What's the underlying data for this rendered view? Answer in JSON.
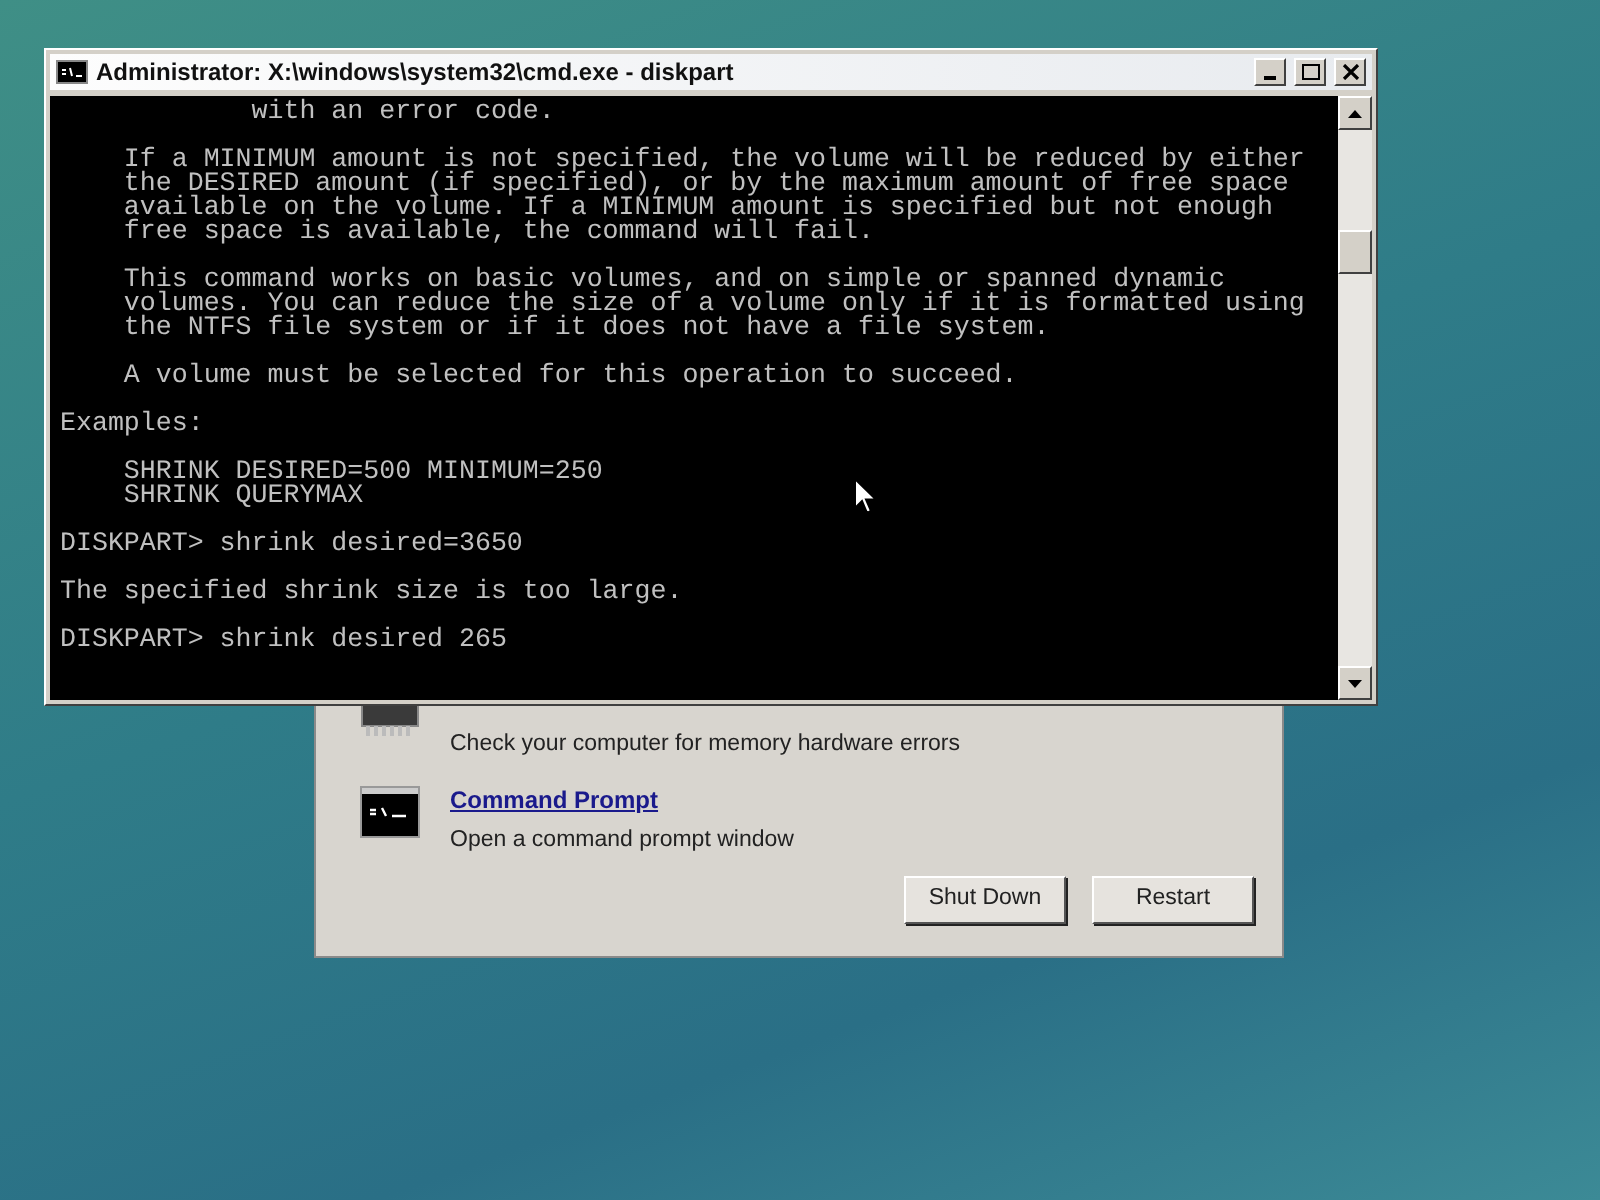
{
  "recovery_window": {
    "tools": [
      {
        "kind": "memory",
        "description": "Check your computer for memory hardware errors"
      },
      {
        "kind": "console",
        "name": "Command Prompt",
        "description": "Open a command prompt window"
      }
    ],
    "buttons": [
      "Shut Down",
      "Restart"
    ]
  },
  "console_window": {
    "title": "Administrator: X:\\windows\\system32\\cmd.exe - diskpart",
    "blocks": [
      {
        "lines": [
          "            with an error code."
        ]
      },
      {
        "lines": [
          "    If a MINIMUM amount is not specified, the volume will be reduced by either",
          "    the DESIRED amount (if specified), or by the maximum amount of free space",
          "    available on the volume. If a MINIMUM amount is specified but not enough",
          "    free space is available, the command will fail."
        ]
      },
      {
        "lines": [
          "    This command works on basic volumes, and on simple or spanned dynamic",
          "    volumes. You can reduce the size of a volume only if it is formatted using",
          "    the NTFS file system or if it does not have a file system."
        ]
      },
      {
        "lines": [
          "    A volume must be selected for this operation to succeed."
        ]
      },
      {
        "lines": [
          "Examples:"
        ]
      },
      {
        "lines": [
          "    SHRINK DESIRED=500 MINIMUM=250",
          "    SHRINK QUERYMAX"
        ]
      },
      {
        "lines": [
          "DISKPART> shrink desired=3650"
        ]
      },
      {
        "lines": [
          "The specified shrink size is too large."
        ]
      },
      {
        "lines": [
          "DISKPART> shrink desired 265"
        ]
      }
    ]
  }
}
